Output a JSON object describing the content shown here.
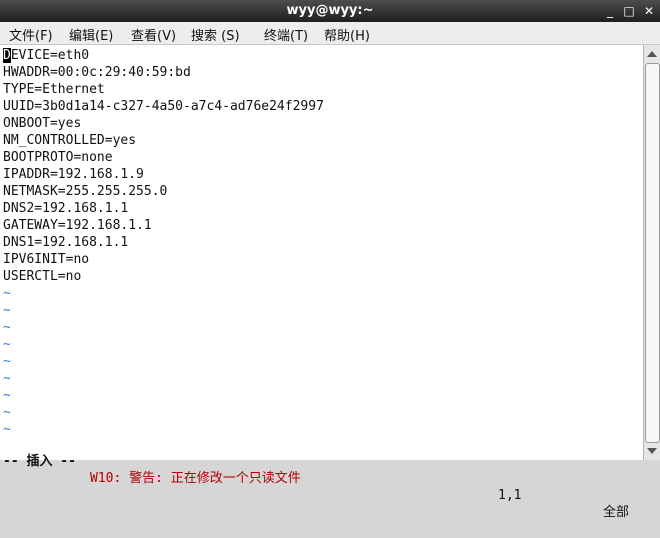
{
  "window": {
    "title": "wyy@wyy:~",
    "minimize_glyph": "_",
    "maximize_glyph": "□",
    "close_glyph": "✕"
  },
  "menu": [
    "文件(F)",
    "编辑(E)",
    "查看(V)",
    "搜索 (S)",
    "终端(T)",
    "帮助(H)"
  ],
  "editor": {
    "cursor_char": "D",
    "first_line_rest": "EVICE=eth0",
    "lines": [
      "HWADDR=00:0c:29:40:59:bd",
      "TYPE=Ethernet",
      "UUID=3b0d1a14-c327-4a50-a7c4-ad76e24f2997",
      "ONBOOT=yes",
      "NM_CONTROLLED=yes",
      "BOOTPROTO=none",
      "IPADDR=192.168.1.9",
      "NETMASK=255.255.255.0",
      "DNS2=192.168.1.1",
      "GATEWAY=192.168.1.1",
      "DNS1=192.168.1.1",
      "IPV6INIT=no",
      "USERCTL=no"
    ],
    "tilde": "~",
    "tilde_count": 9
  },
  "status": {
    "mode": "-- 插入 --",
    "warning": "W10: 警告: 正在修改一个只读文件",
    "position": "1,1",
    "scroll": "全部"
  }
}
